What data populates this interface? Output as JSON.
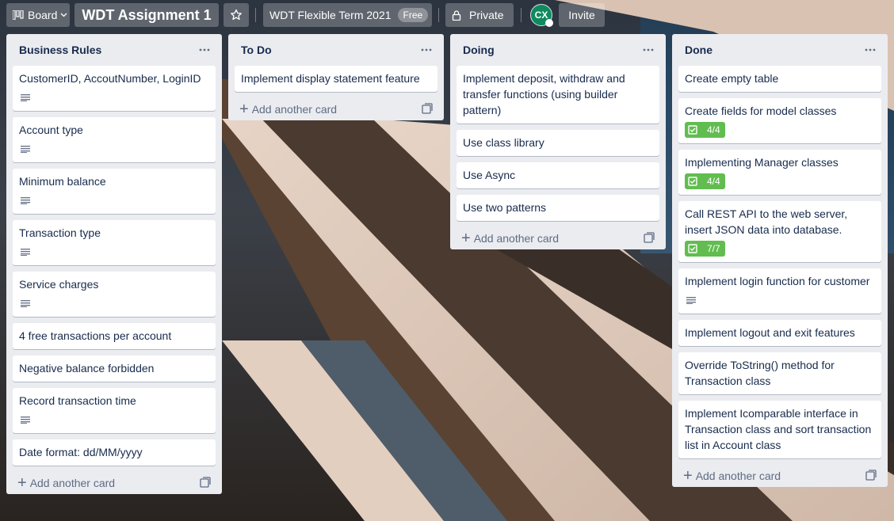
{
  "header": {
    "board_label": "Board",
    "board_title": "WDT Assignment 1",
    "team_name": "WDT Flexible Term 2021",
    "team_badge": "Free",
    "visibility": "Private",
    "avatar_initials": "CX",
    "invite_label": "Invite"
  },
  "add_card_label": "Add another card",
  "lists": [
    {
      "title": "Business Rules",
      "cards": [
        {
          "text": "CustomerID, AccoutNumber, LoginID",
          "description": true
        },
        {
          "text": "Account type",
          "description": true
        },
        {
          "text": "Minimum balance",
          "description": true
        },
        {
          "text": "Transaction type",
          "description": true
        },
        {
          "text": "Service charges",
          "description": true
        },
        {
          "text": "4 free transactions per account"
        },
        {
          "text": "Negative balance forbidden"
        },
        {
          "text": "Record transaction time",
          "description": true
        },
        {
          "text": "Date format: dd/MM/yyyy"
        }
      ]
    },
    {
      "title": "To Do",
      "cards": [
        {
          "text": "Implement display statement feature"
        }
      ]
    },
    {
      "title": "Doing",
      "cards": [
        {
          "text": "Implement deposit, withdraw and transfer functions (using builder pattern)"
        },
        {
          "text": "Use class library"
        },
        {
          "text": "Use Async"
        },
        {
          "text": "Use two patterns"
        }
      ]
    },
    {
      "title": "Done",
      "cards": [
        {
          "text": "Create empty table"
        },
        {
          "text": "Create fields for model classes",
          "checklist": "4/4"
        },
        {
          "text": "Implementing Manager classes",
          "checklist": "4/4"
        },
        {
          "text": "Call REST API to the web server, insert JSON data into database.",
          "checklist": "7/7"
        },
        {
          "text": "Implement login function for customer",
          "description": true
        },
        {
          "text": "Implement logout and exit features"
        },
        {
          "text": "Override ToString() method for Transaction class"
        },
        {
          "text": "Implement Icomparable interface in Transaction class and sort transaction list in Account class"
        }
      ]
    }
  ],
  "colors": {
    "list_bg": "#ebecf0",
    "checklist_complete": "#61bd4f",
    "avatar": "#0f8a5f"
  }
}
